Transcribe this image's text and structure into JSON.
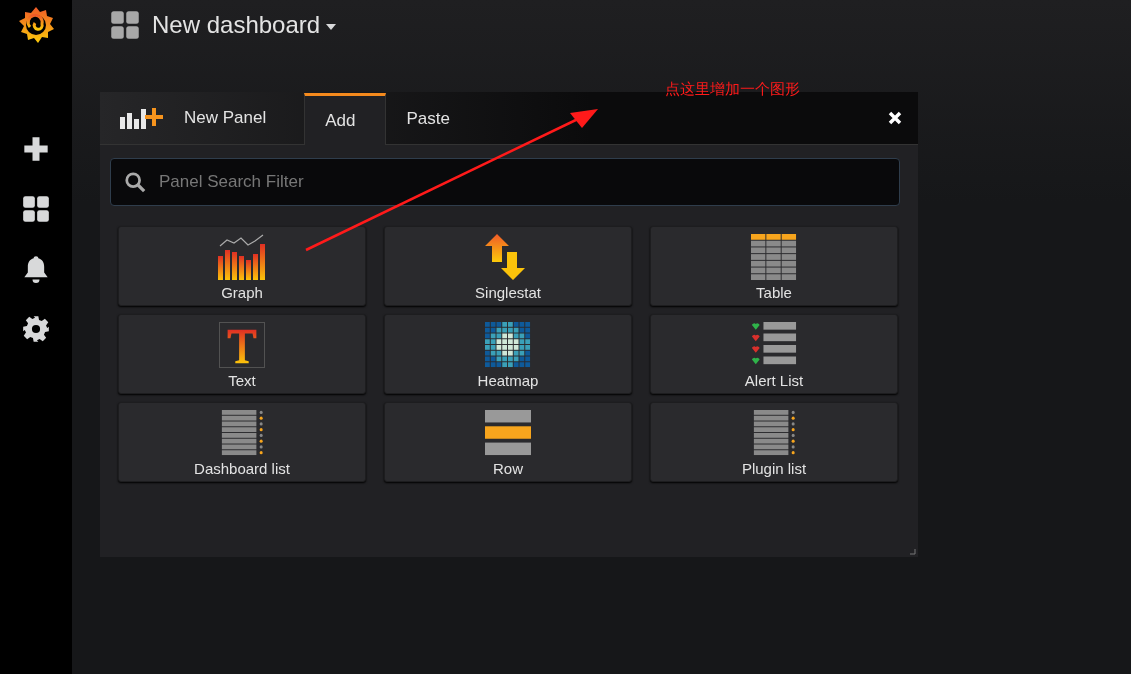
{
  "header": {
    "title": "New dashboard"
  },
  "panel": {
    "title": "New Panel",
    "tabs": [
      {
        "label": "Add",
        "selected": true
      },
      {
        "label": "Paste",
        "selected": false
      }
    ],
    "search": {
      "placeholder": "Panel Search Filter"
    },
    "items": [
      {
        "label": "Graph",
        "kind": "graph"
      },
      {
        "label": "Singlestat",
        "kind": "singlestat"
      },
      {
        "label": "Table",
        "kind": "table"
      },
      {
        "label": "Text",
        "kind": "text"
      },
      {
        "label": "Heatmap",
        "kind": "heatmap"
      },
      {
        "label": "Alert List",
        "kind": "alertlist"
      },
      {
        "label": "Dashboard list",
        "kind": "dashlist"
      },
      {
        "label": "Row",
        "kind": "row"
      },
      {
        "label": "Plugin list",
        "kind": "pluginlist"
      }
    ]
  },
  "annotation": {
    "text": "点这里增加一个图形"
  }
}
